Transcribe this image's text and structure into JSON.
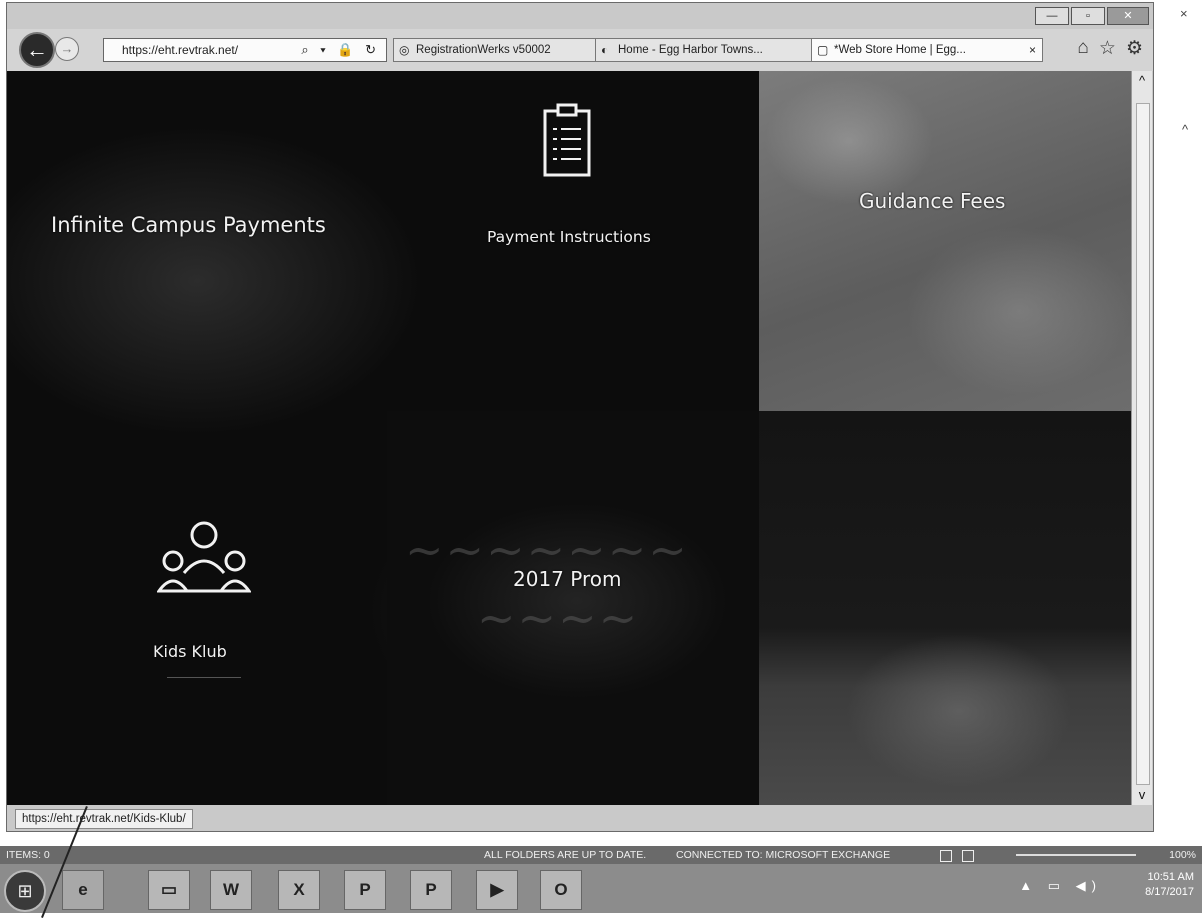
{
  "browser": {
    "address_url": "https://eht.revtrak.net/",
    "address_controls": "⌕ ▾ 🔒 ↻",
    "tabs": [
      {
        "label": "RegistrationWerks v50002",
        "active": false
      },
      {
        "label": "Home - Egg Harbor Towns...",
        "active": false
      },
      {
        "label": "*Web Store Home | Egg...",
        "active": true
      }
    ],
    "tab_close": "×",
    "status_url": "https://eht.revtrak.net/Kids-Klub/"
  },
  "tiles": {
    "infinite_campus": "Infinite Campus Payments",
    "payment_instructions": "Payment Instructions",
    "guidance_fees": "Guidance Fees",
    "prom": "2017 Prom",
    "kids_klub": "Kids Klub"
  },
  "outlook_status": {
    "items": "ITEMS: 0",
    "folders": "ALL FOLDERS ARE UP TO DATE.",
    "exchange": "CONNECTED TO: MICROSOFT EXCHANGE",
    "zoom": "100%"
  },
  "taskbar": {
    "apps": [
      "W",
      "X",
      "P",
      "P",
      "▶",
      "O"
    ],
    "time": "10:51 AM",
    "date": "8/17/2017"
  },
  "icons": {
    "back": "back-arrow-icon",
    "forward": "forward-arrow-icon",
    "home": "home-icon",
    "favorites": "star-icon",
    "settings": "gear-icon",
    "clipboard": "clipboard-checklist-icon",
    "people": "people-group-icon"
  }
}
